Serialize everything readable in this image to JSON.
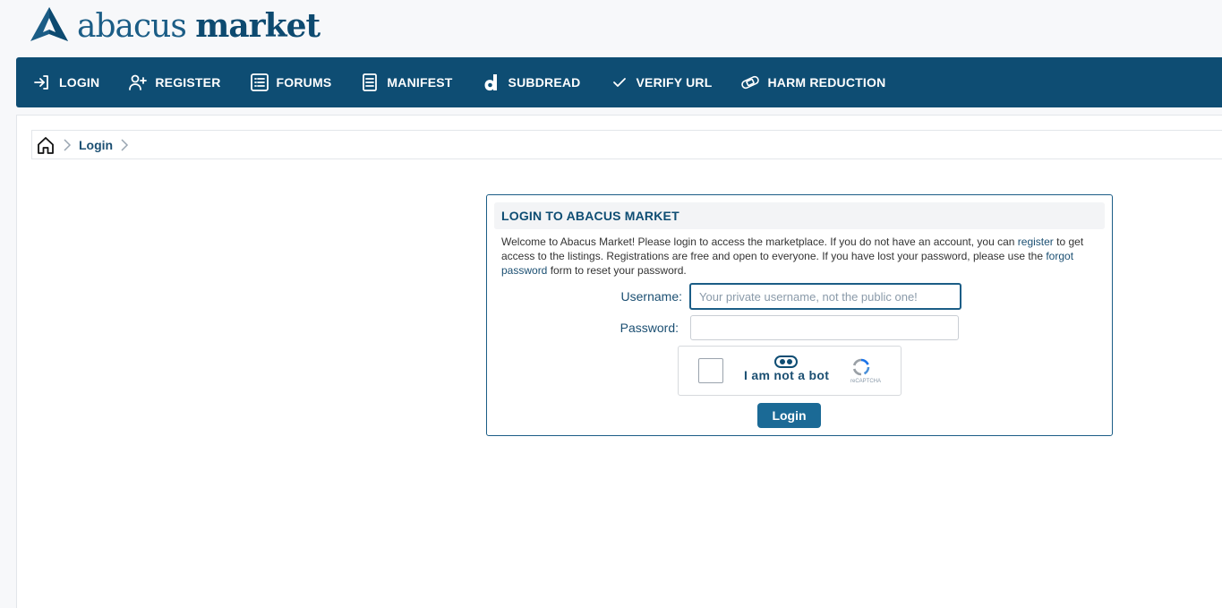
{
  "brand": {
    "word1": "abacus",
    "word2": "market"
  },
  "nav": {
    "items": [
      {
        "label": "LOGIN",
        "icon": "login-icon"
      },
      {
        "label": "REGISTER",
        "icon": "user-plus-icon"
      },
      {
        "label": "FORUMS",
        "icon": "list-icon"
      },
      {
        "label": "MANIFEST",
        "icon": "document-icon"
      },
      {
        "label": "SUBDREAD",
        "icon": "dread-icon"
      },
      {
        "label": "VERIFY URL",
        "icon": "check-icon"
      },
      {
        "label": "HARM REDUCTION",
        "icon": "bandage-icon"
      }
    ]
  },
  "breadcrumb": {
    "current": "Login"
  },
  "login": {
    "title": "LOGIN TO ABACUS MARKET",
    "desc_part1": "Welcome to Abacus Market! Please login to access the marketplace. If you do not have an account, you can ",
    "register_link": "register",
    "desc_part2": " to get access to the listings. Registrations are free and open to everyone. If you have lost your password, please use the ",
    "forgot_link": "forgot password",
    "desc_part3": " form to reset your password.",
    "username_label": "Username:",
    "username_placeholder": "Your private username, not the public one!",
    "username_value": "",
    "password_label": "Password:",
    "password_value": "",
    "captcha_label": "I am not a bot",
    "captcha_brand": "reCAPTCHA",
    "submit_label": "Login"
  },
  "colors": {
    "accent": "#0e4d73",
    "button": "#1b6a96",
    "link": "#1b4f72"
  }
}
